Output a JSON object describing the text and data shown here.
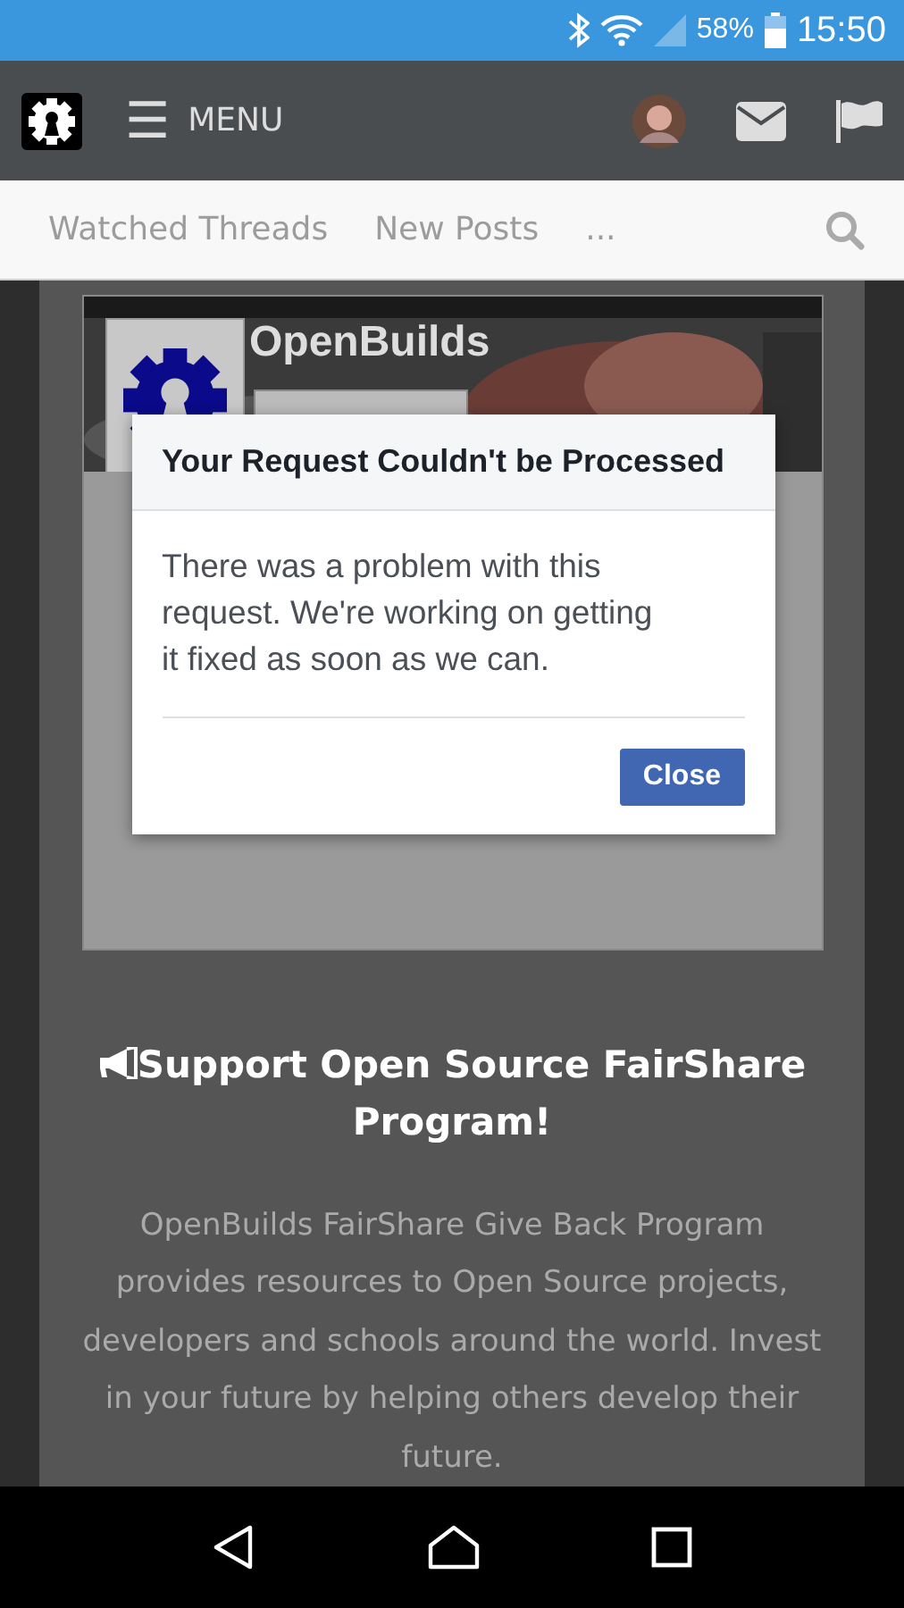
{
  "status_bar": {
    "battery": "58%",
    "time": "15:50"
  },
  "top_nav": {
    "menu_label": "MENU",
    "menu_glyph": "☰"
  },
  "sub_nav": {
    "links": [
      {
        "label": "Watched Threads"
      },
      {
        "label": "New Posts"
      },
      {
        "label": "..."
      }
    ]
  },
  "widget": {
    "page_name": "OpenBuilds"
  },
  "dialog": {
    "title": "Your Request Couldn't be Processed",
    "message": "There was a problem with this request. We're working on getting it fixed as soon as we can.",
    "button": "Close"
  },
  "promo": {
    "heading": "Support Open Source FairShare Program!",
    "text": "OpenBuilds FairShare Give Back Program provides resources to Open Source projects, developers and schools around the world. Invest in your future by helping others develop their future."
  }
}
